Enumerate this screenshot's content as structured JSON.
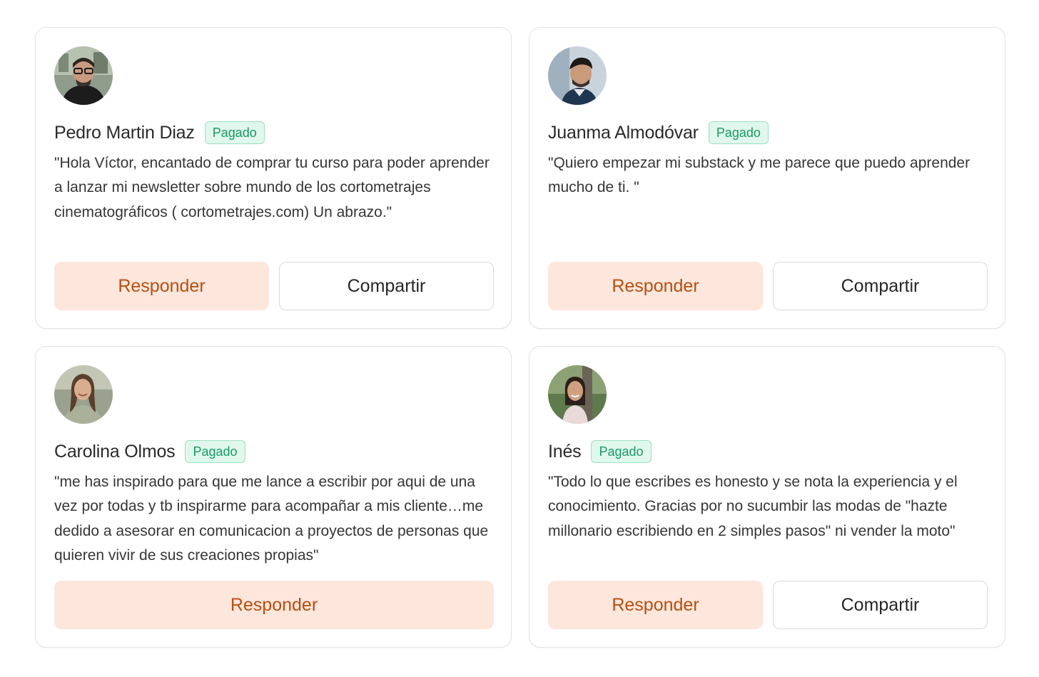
{
  "cards": [
    {
      "name": "Pedro Martin Diaz",
      "badge": "Pagado",
      "message": "\"Hola Víctor, encantado de comprar tu curso para poder aprender a lanzar mi newsletter sobre mundo de los cortometrajes cinematográficos ( cortometrajes.com) Un abrazo.\"",
      "reply_label": "Responder",
      "share_label": "Compartir"
    },
    {
      "name": "Juanma Almodóvar",
      "badge": "Pagado",
      "message": "\"Quiero empezar mi substack y me parece que puedo aprender mucho de ti. \"",
      "reply_label": "Responder",
      "share_label": "Compartir"
    },
    {
      "name": "Carolina Olmos",
      "badge": "Pagado",
      "message": "\"me has inspirado para que me lance a escribir por aqui de una vez por todas y tb inspirarme para acompañar a mis cliente…me dedido a asesorar en comunicacion a proyectos de personas que quieren vivir de sus creaciones propias\"",
      "reply_label": "Responder"
    },
    {
      "name": "Inés",
      "badge": "Pagado",
      "message": "\"Todo lo que escribes es honesto y se nota la experiencia y el conocimiento. Gracias por no sucumbir las modas de \"hazte millonario escribiendo en 2 simples pasos\" ni vender la moto\"",
      "reply_label": "Responder",
      "share_label": "Compartir"
    }
  ],
  "colors": {
    "badge_text": "#1a9a63",
    "badge_bg": "#dff7ec",
    "reply_bg": "#fde6dc",
    "reply_text": "#b6500f"
  }
}
